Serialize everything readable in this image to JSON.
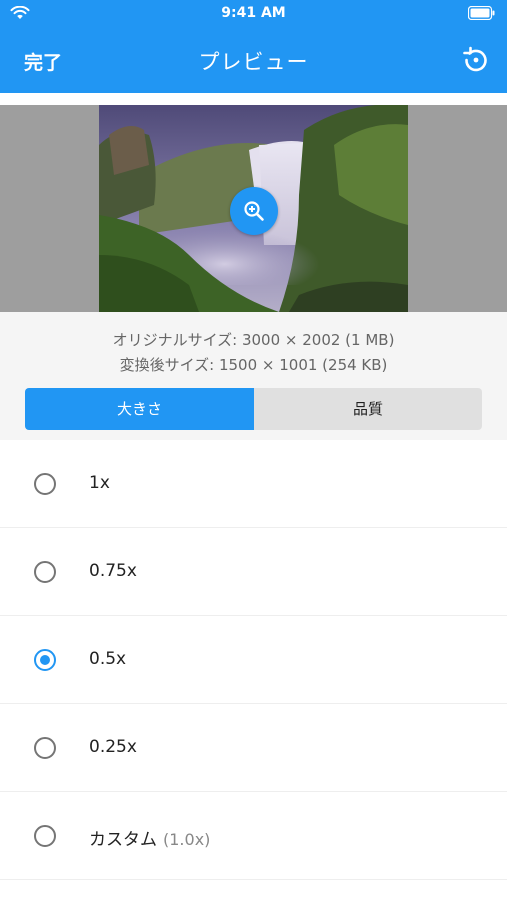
{
  "status_bar": {
    "time": "9:41 AM",
    "icons": [
      "wifi-icon",
      "battery-icon"
    ]
  },
  "nav": {
    "done_label": "完了",
    "title": "プレビュー",
    "reset_icon": "reset-icon"
  },
  "preview": {
    "zoom_icon": "zoom-in-icon"
  },
  "info": {
    "original": "オリジナルサイズ: 3000 × 2002 (1 MB)",
    "converted": "変換後サイズ: 1500 × 1001 (254 KB)"
  },
  "tabs": {
    "size_label": "大きさ",
    "quality_label": "品質",
    "selected": "size"
  },
  "options": [
    {
      "label": "1x",
      "selected": false
    },
    {
      "label": "0.75x",
      "selected": false
    },
    {
      "label": "0.5x",
      "selected": true
    },
    {
      "label": "0.25x",
      "selected": false
    },
    {
      "label": "カスタム",
      "sub": "(1.0x)",
      "selected": false
    }
  ],
  "colors": {
    "accent": "#2196f3",
    "panel": "#f5f5f5",
    "preview_bg": "#9e9e9e"
  }
}
